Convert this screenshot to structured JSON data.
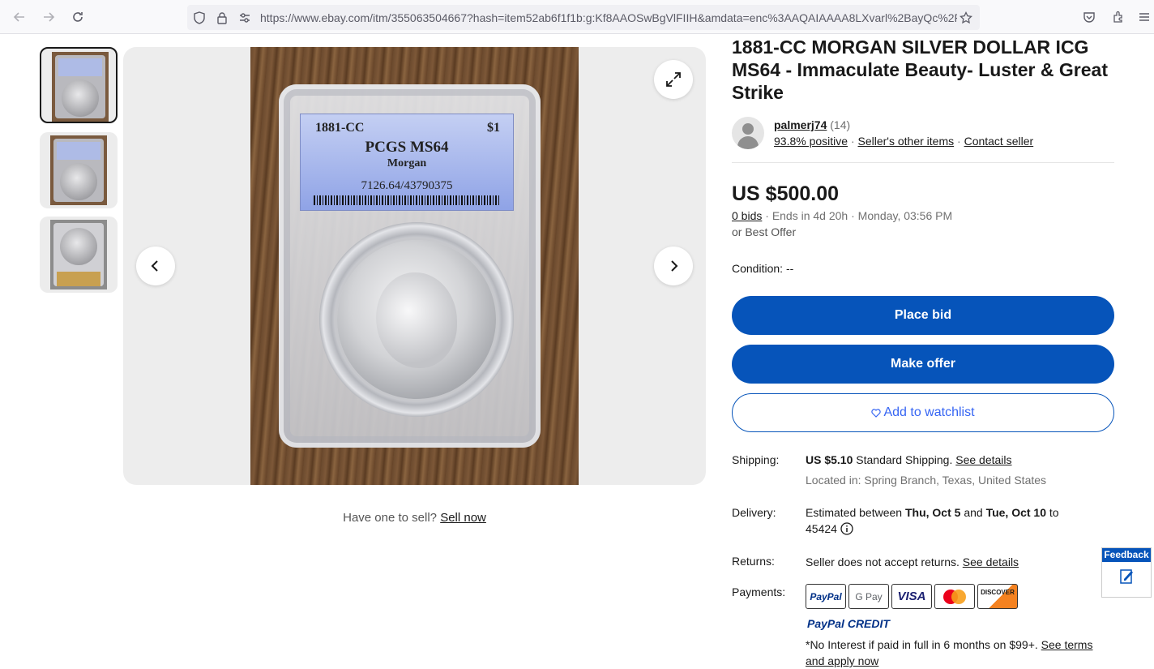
{
  "browser": {
    "url": "https://www.ebay.com/itm/355063504667?hash=item52ab6f1f1b:g:Kf8AAOSwBgVlFIIH&amdata=enc%3AAQAIAAAA8LXvarl%2BayQc%2Fl"
  },
  "slab": {
    "year": "1881-CC",
    "denomination": "$1",
    "grade": "PCGS MS64",
    "type": "Morgan",
    "cert": "7126.64/43790375"
  },
  "listing": {
    "title": "1881-CC MORGAN SILVER DOLLAR ICG MS64 - Immaculate Beauty- Luster & Great Strike",
    "seller": {
      "name": "palmerj74",
      "rating_count": "(14)",
      "positive": "93.8% positive",
      "other_items": "Seller's other items",
      "contact": "Contact seller"
    },
    "price": "US $500.00",
    "bids": "0 bids",
    "ends": "Ends in 4d 20h",
    "end_time": "Monday, 03:56 PM",
    "best_offer": "or Best Offer",
    "condition_label": "Condition:",
    "condition_value": "--",
    "place_bid": "Place bid",
    "make_offer": "Make offer",
    "watchlist": "Add to watchlist",
    "shipping_label": "Shipping:",
    "shipping_price": "US $5.10",
    "shipping_method": "Standard Shipping.",
    "see_details": "See details",
    "located": "Located in: Spring Branch, Texas, United States",
    "delivery_label": "Delivery:",
    "delivery_prefix": "Estimated between",
    "delivery_start": "Thu, Oct 5",
    "delivery_and": "and",
    "delivery_end": "Tue, Oct 10",
    "delivery_to": "to",
    "delivery_zip": "45424",
    "returns_label": "Returns:",
    "returns_text": "Seller does not accept returns.",
    "payments_label": "Payments:",
    "payment_methods": [
      "PayPal",
      "G Pay",
      "VISA",
      "Mastercard",
      "DISCOVER"
    ],
    "paypal_credit_a": "PayPal",
    "paypal_credit_b": "CREDIT",
    "promo_text": "*No Interest if paid in full in 6 months on $99+.",
    "promo_link": "See terms and apply now"
  },
  "sell": {
    "prompt": "Have one to sell?",
    "link": "Sell now"
  },
  "feedback": {
    "label": "Feedback"
  }
}
